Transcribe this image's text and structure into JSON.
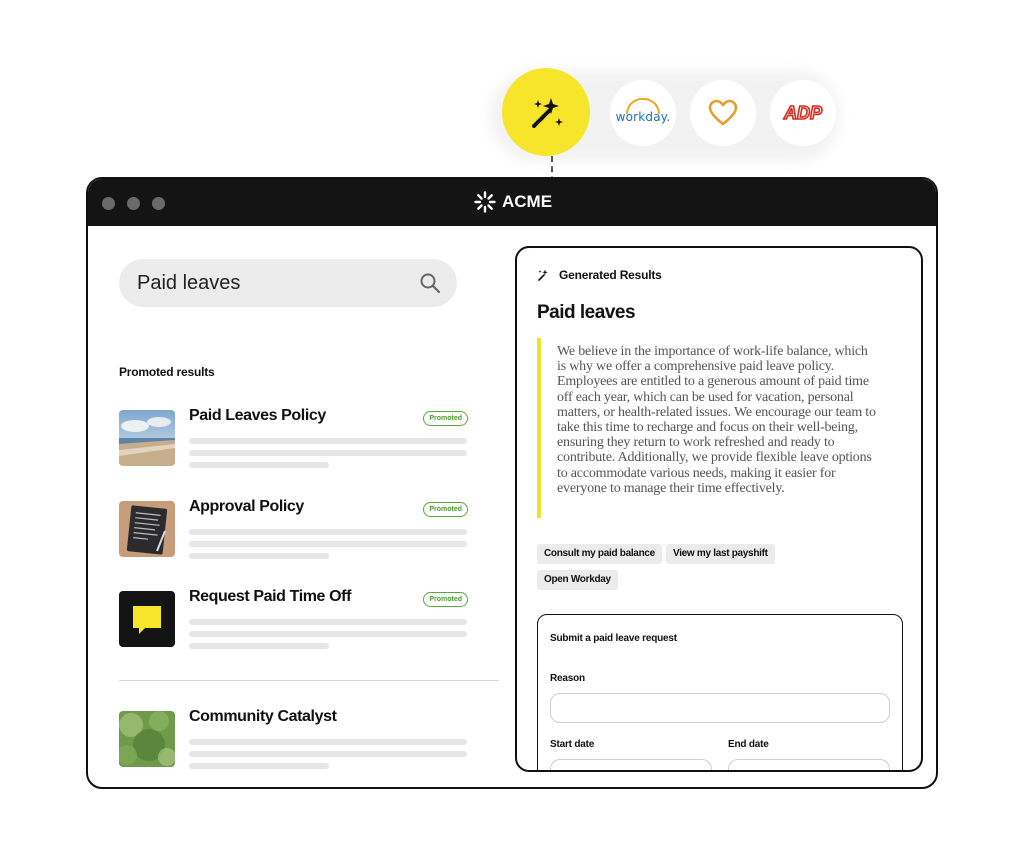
{
  "integrations": [
    {
      "name": "magic-wand",
      "label": ""
    },
    {
      "name": "workday",
      "label": "workday."
    },
    {
      "name": "heart",
      "label": ""
    },
    {
      "name": "adp",
      "label": "ADP"
    }
  ],
  "window": {
    "brand": "ACME"
  },
  "search": {
    "value": "Paid leaves"
  },
  "promoted": {
    "heading": "Promoted results",
    "items": [
      {
        "title": "Paid Leaves Policy",
        "badge": "Promoted",
        "thumb": "beach-photo"
      },
      {
        "title": "Approval Policy",
        "badge": "Promoted",
        "thumb": "document-photo"
      },
      {
        "title": "Request Paid Time Off",
        "badge": "Promoted",
        "thumb": "chat-icon"
      }
    ]
  },
  "other": {
    "title": "Community Catalyst",
    "thumb": "foliage-photo"
  },
  "generated": {
    "header": "Generated Results",
    "title": "Paid leaves",
    "body": "We believe in the importance of work-life balance, which is why we offer a comprehensive paid leave policy. Employees are entitled to a generous amount of paid time off each year, which can be used for vacation, personal matters, or health-related issues. We encourage our team to take this time to recharge and focus on their well-being, ensuring they return to work refreshed and ready to contribute. Additionally, we provide flexible leave options to accommodate various needs, making it easier for everyone to manage their time effectively.",
    "actions": [
      "Consult my paid balance",
      "View my last payshift",
      "Open Workday"
    ],
    "form": {
      "title": "Submit a paid leave request",
      "reason_label": "Reason",
      "start_label": "Start date",
      "end_label": "End date"
    }
  },
  "colors": {
    "accent_yellow": "#f6e52b",
    "promoted_green": "#4a9a2a",
    "titlebar": "#141414"
  }
}
